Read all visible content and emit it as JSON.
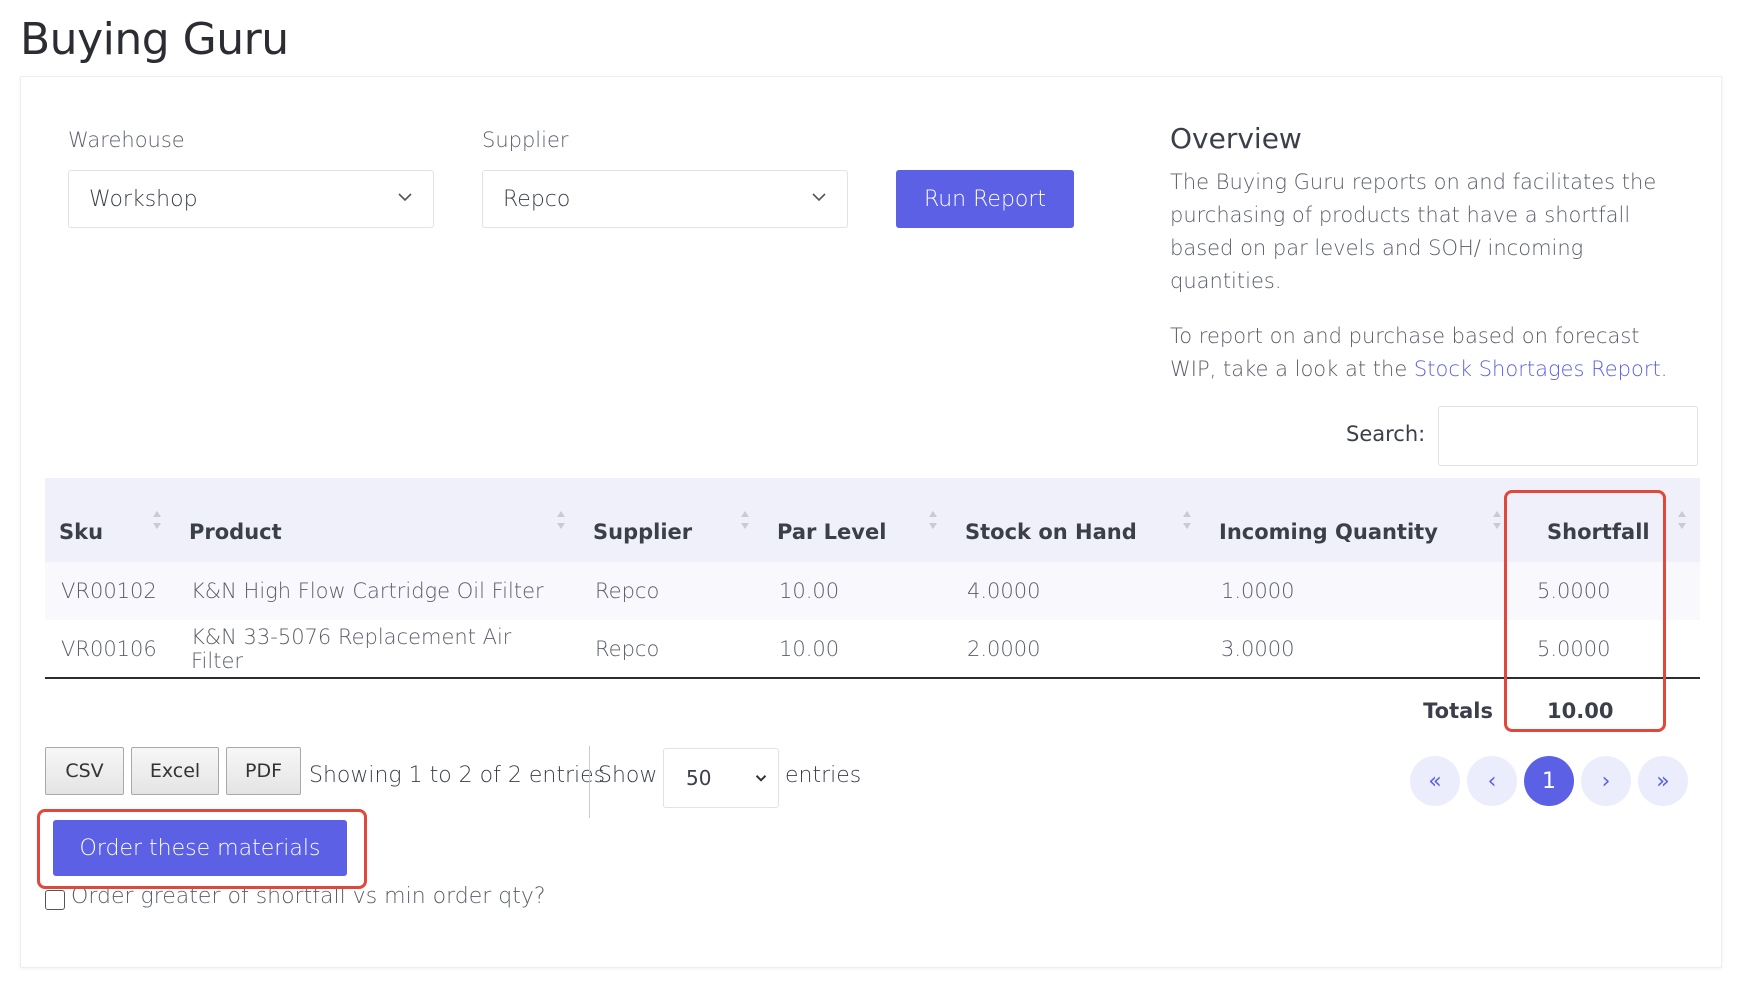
{
  "page": {
    "title": "Buying Guru"
  },
  "filters": {
    "warehouse_label": "Warehouse",
    "warehouse_value": "Workshop",
    "supplier_label": "Supplier",
    "supplier_value": "Repco",
    "run_button": "Run Report"
  },
  "overview": {
    "title": "Overview",
    "paragraph1": "The Buying Guru reports on and facilitates the purchasing of products that have a shortfall based on par levels and SOH/ incoming quantities.",
    "paragraph2_prefix": "To report on and purchase based on forecast WIP, take a look at the ",
    "paragraph2_link": "Stock Shortages Report",
    "paragraph2_suffix": "."
  },
  "search": {
    "label": "Search:",
    "value": ""
  },
  "table": {
    "columns": [
      "Sku",
      "Product",
      "Supplier",
      "Par Level",
      "Stock on Hand",
      "Incoming Quantity",
      "Shortfall"
    ],
    "rows": [
      {
        "sku": "VR00102",
        "product": "K&N High Flow Cartridge Oil Filter",
        "supplier": "Repco",
        "par_level": "10.00",
        "stock_on_hand": "4.0000",
        "incoming_quantity": "1.0000",
        "shortfall": "5.0000"
      },
      {
        "sku": "VR00106",
        "product": "K&N 33-5076 Replacement Air Filter",
        "supplier": "Repco",
        "par_level": "10.00",
        "stock_on_hand": "2.0000",
        "incoming_quantity": "3.0000",
        "shortfall": "5.0000"
      }
    ],
    "totals_label": "Totals",
    "totals_value": "10.00"
  },
  "export": {
    "csv": "CSV",
    "excel": "Excel",
    "pdf": "PDF"
  },
  "info": {
    "showing": "Showing 1 to 2 of 2 entries",
    "show_label": "Show",
    "page_length": "50",
    "entries_label": "entries"
  },
  "pagination": {
    "first": "«",
    "prev": "‹",
    "current": "1",
    "next": "›",
    "last": "»"
  },
  "actions": {
    "order_button": "Order these materials",
    "order_greater_label": "Order greater of shortfall vs min order qty?"
  },
  "colors": {
    "accent": "#5c60e5",
    "highlight": "#e0483b",
    "header_bg": "#f0f0fa"
  }
}
